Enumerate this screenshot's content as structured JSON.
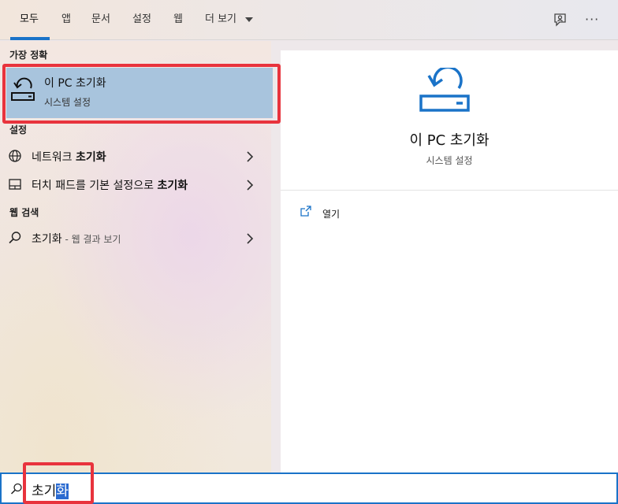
{
  "tabs": [
    {
      "label": "모두",
      "active": true
    },
    {
      "label": "앱"
    },
    {
      "label": "문서"
    },
    {
      "label": "설정"
    },
    {
      "label": "웹"
    },
    {
      "label": "더 보기"
    }
  ],
  "top_icons": [
    "feedback-icon",
    "more-options-icon"
  ],
  "more_icon_glyph": "···",
  "best_match": {
    "section_title": "가장 정확",
    "title": "이 PC 초기화",
    "subtitle": "시스템 설정",
    "icon": "reset-pc-icon"
  },
  "settings_section": {
    "title": "설정",
    "items": [
      {
        "label_prefix": "네트워크 ",
        "label_bold": "초기화",
        "icon": "network-globe-icon"
      },
      {
        "label_prefix": "터치 패드를 기본 설정으로 ",
        "label_bold": "초기화",
        "icon": "touchpad-icon"
      }
    ]
  },
  "web_section": {
    "title": "웹 검색",
    "items": [
      {
        "query": "초기화",
        "suffix": " - 웹 결과 보기",
        "icon": "search-icon"
      }
    ]
  },
  "detail_panel": {
    "title": "이 PC 초기화",
    "subtitle": "시스템 설정",
    "icon": "reset-pc-icon",
    "actions": [
      {
        "label": "열기",
        "icon": "open-icon"
      }
    ]
  },
  "search": {
    "typed": "초기",
    "selected": "화",
    "icon": "search-icon"
  },
  "colors": {
    "accent": "#1a73c8",
    "highlight_selection": "#a8c4dd",
    "annotation_red": "#e8333d"
  }
}
